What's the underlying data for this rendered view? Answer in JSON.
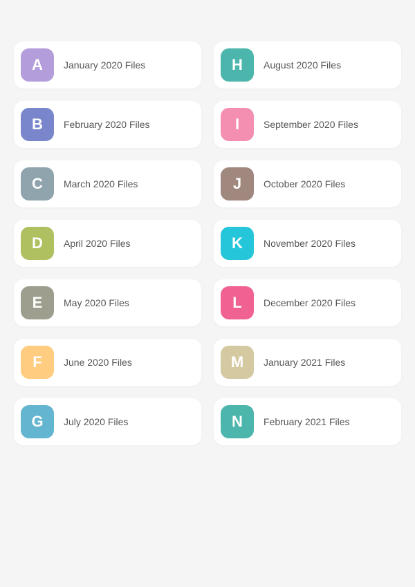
{
  "folders": [
    {
      "id": "a",
      "letter": "A",
      "label": "January 2020 Files",
      "color": "#b39ddb"
    },
    {
      "id": "h",
      "letter": "H",
      "label": "August 2020 Files",
      "color": "#4db6ac"
    },
    {
      "id": "b",
      "letter": "B",
      "label": "February 2020 Files",
      "color": "#7986cb"
    },
    {
      "id": "i",
      "letter": "I",
      "label": "September 2020 Files",
      "color": "#f48fb1"
    },
    {
      "id": "c",
      "letter": "C",
      "label": "March 2020 Files",
      "color": "#90a4ae"
    },
    {
      "id": "j",
      "letter": "J",
      "label": "October 2020 Files",
      "color": "#a1887f"
    },
    {
      "id": "d",
      "letter": "D",
      "label": "April 2020 Files",
      "color": "#aec060"
    },
    {
      "id": "k",
      "letter": "K",
      "label": "November 2020 Files",
      "color": "#26c6da"
    },
    {
      "id": "e",
      "letter": "E",
      "label": "May 2020 Files",
      "color": "#9e9e8e"
    },
    {
      "id": "l",
      "letter": "L",
      "label": "December 2020 Files",
      "color": "#f06292"
    },
    {
      "id": "f",
      "letter": "F",
      "label": "June 2020 Files",
      "color": "#ffcc80"
    },
    {
      "id": "m",
      "letter": "M",
      "label": "January 2021 Files",
      "color": "#d4c9a0"
    },
    {
      "id": "g",
      "letter": "G",
      "label": "July 2020 Files",
      "color": "#64b5d0"
    },
    {
      "id": "n",
      "letter": "N",
      "label": "February 2021 Files",
      "color": "#4db6ac"
    }
  ]
}
